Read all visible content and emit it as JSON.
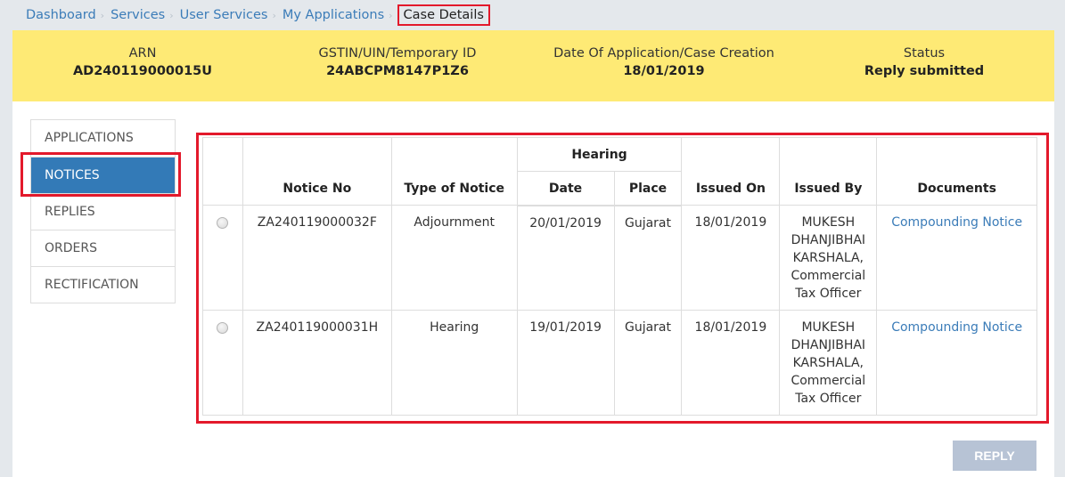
{
  "breadcrumb": {
    "items": [
      "Dashboard",
      "Services",
      "User Services",
      "My Applications"
    ],
    "current": "Case Details",
    "separator": "›"
  },
  "summary": {
    "arn_label": "ARN",
    "arn_value": "AD240119000015U",
    "gstin_label": "GSTIN/UIN/Temporary ID",
    "gstin_value": "24ABCPM8147P1Z6",
    "date_label": "Date Of Application/Case Creation",
    "date_value": "18/01/2019",
    "status_label": "Status",
    "status_value": "Reply submitted"
  },
  "sidenav": {
    "items": [
      {
        "label": "APPLICATIONS",
        "active": false
      },
      {
        "label": "NOTICES",
        "active": true
      },
      {
        "label": "REPLIES",
        "active": false
      },
      {
        "label": "ORDERS",
        "active": false
      },
      {
        "label": "RECTIFICATION",
        "active": false
      }
    ]
  },
  "table": {
    "headers": {
      "notice_no": "Notice No",
      "type": "Type of Notice",
      "hearing": "Hearing",
      "hearing_date": "Date",
      "hearing_place": "Place",
      "issued_on": "Issued On",
      "issued_by": "Issued By",
      "documents": "Documents"
    },
    "rows": [
      {
        "notice_no": "ZA240119000032F",
        "type": "Adjournment",
        "hearing_date": "20/01/2019",
        "hearing_place": "Gujarat",
        "issued_on": "18/01/2019",
        "issued_by": "MUKESH DHANJIBHAI KARSHALA, Commercial Tax Officer",
        "document": "Compounding Notice",
        "selected": false
      },
      {
        "notice_no": "ZA240119000031H",
        "type": "Hearing",
        "hearing_date": "19/01/2019",
        "hearing_place": "Gujarat",
        "issued_on": "18/01/2019",
        "issued_by": "MUKESH DHANJIBHAI KARSHALA, Commercial Tax Officer",
        "document": "Compounding Notice",
        "selected": false
      }
    ]
  },
  "actions": {
    "reply_label": "REPLY",
    "reply_enabled": false
  },
  "colors": {
    "summary_bg": "#feea75",
    "accent": "#337ab7",
    "link": "#3b7cb8",
    "highlight": "#e3192b",
    "button_disabled": "#b7c3d5"
  }
}
